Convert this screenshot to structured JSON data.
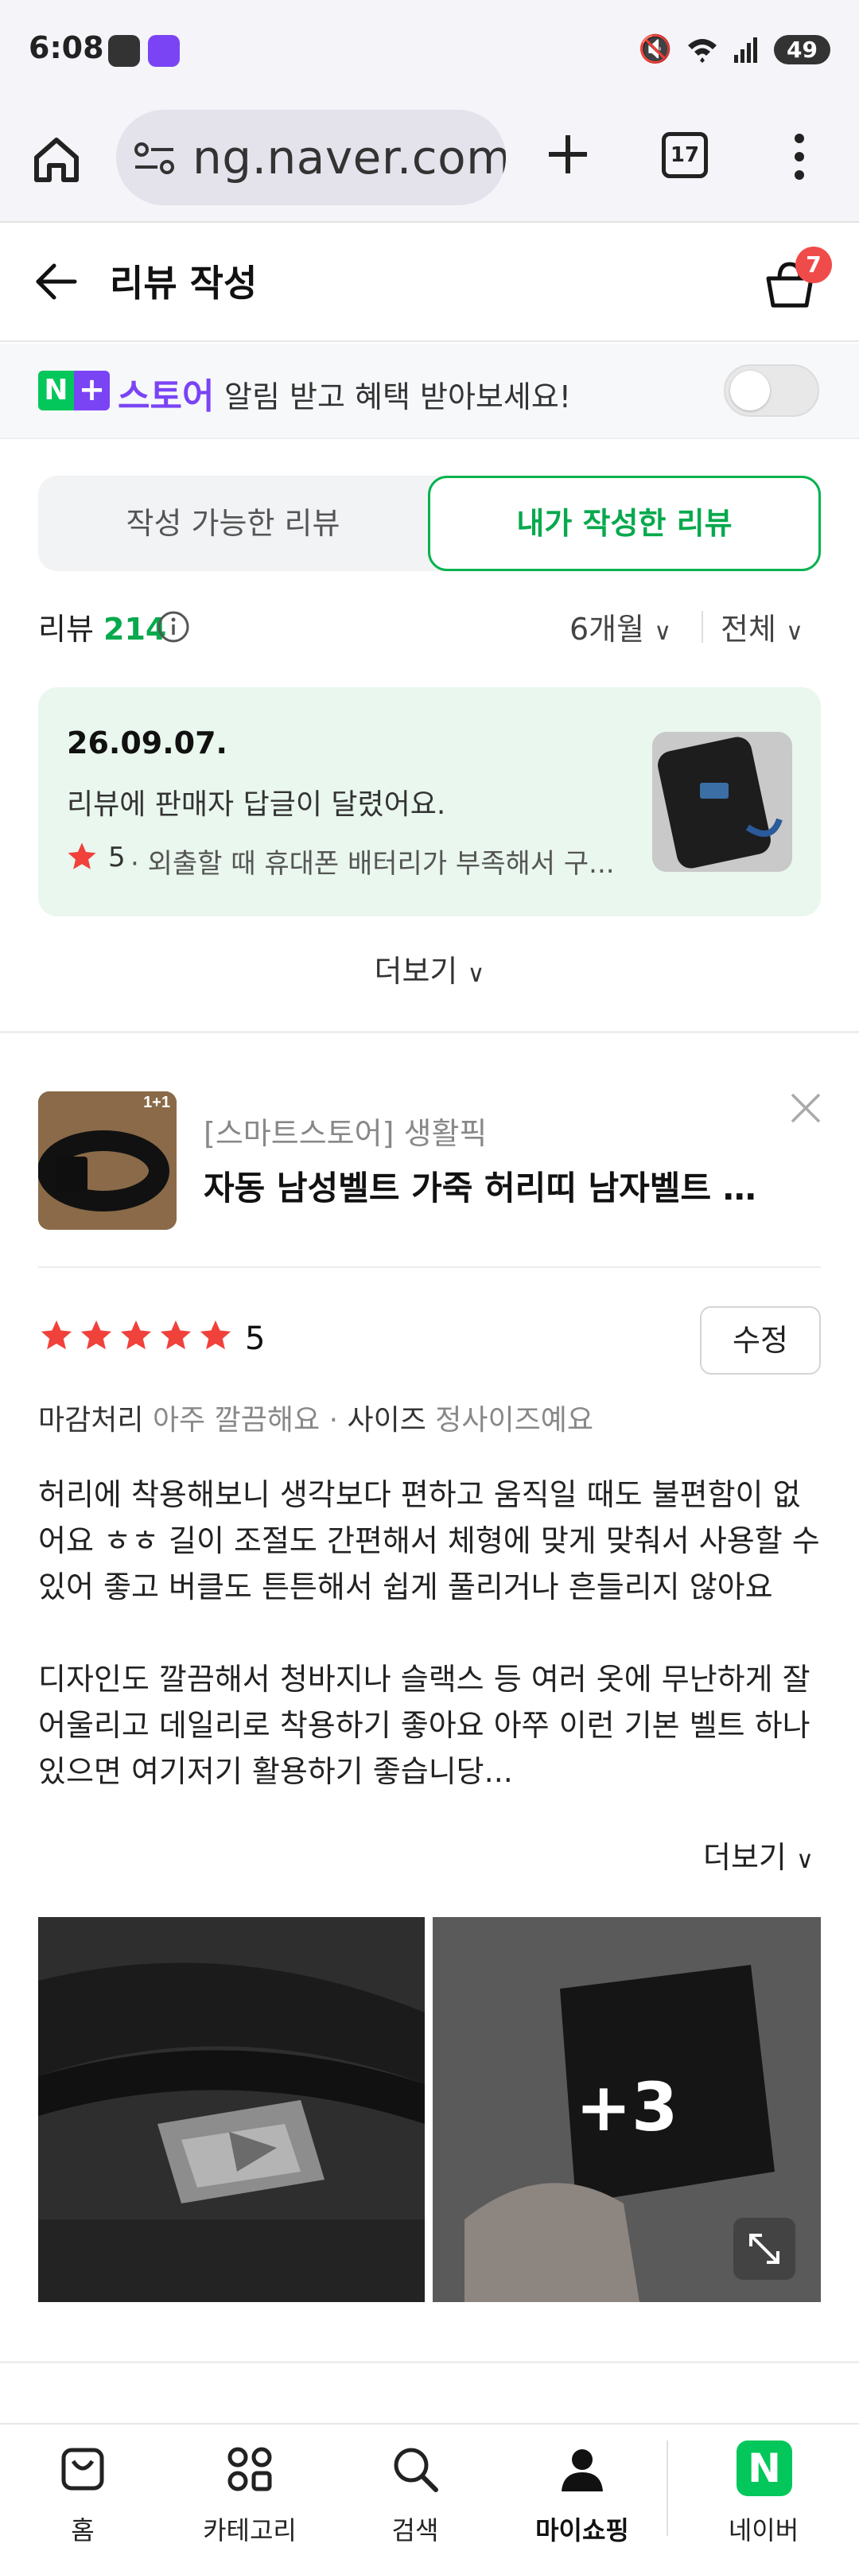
{
  "status_bar": {
    "time": "6:08",
    "battery": "49"
  },
  "browser": {
    "url": "ng.naver.com",
    "tab_count": "17"
  },
  "header": {
    "title": "리뷰 작성",
    "cart_badge": "7"
  },
  "banner": {
    "badge_n": "N",
    "badge_plus": "+",
    "store": "스토어",
    "text": "알림 받고 혜택 받아보세요!"
  },
  "tabs": {
    "writable": "작성 가능한 리뷰",
    "mine": "내가 작성한 리뷰",
    "selected": "mine"
  },
  "review_summary": {
    "label": "리뷰",
    "count": "214",
    "period": "6개월",
    "scope": "전체"
  },
  "reply_card": {
    "date": "26.09.07.",
    "message": "리뷰에 판매자 답글이 달렸어요.",
    "score": "5",
    "snippet": "· 외출할 때 휴대폰 배터리가 부족해서 구..."
  },
  "more_label": "더보기",
  "review": {
    "seller": "[스마트스토어] 생활픽",
    "product_name": "자동 남성벨트 가죽 허리띠 남자벨트 ...",
    "thumb_badge": "1+1",
    "rating": "5",
    "edit_label": "수정",
    "attr1_label": "마감처리",
    "attr1_value": "아주 깔끔해요",
    "attr2_label": "사이즈",
    "attr2_value": "정사이즈예요",
    "body": [
      "허리에 착용해보니 생각보다 편하고 움직일 때도 불편함이 없어요 ㅎㅎ 길이 조절도 간편해서 체형에 맞게 맞춰서 사용할 수 있어 좋고 버클도 튼튼해서 쉽게 풀리거나 흔들리지 않아요",
      "디자인도 깔끔해서 청바지나 슬랙스 등 여러 옷에 무난하게 잘 어울리고 데일리로 착용하기 좋아요 아쭈 이런 기본 벨트 하나 있으면 여기저기 활용하기 좋습니당..."
    ],
    "more_label": "더보기",
    "extra_photos": "+3"
  },
  "bottom_nav": [
    {
      "label": "홈",
      "icon": "home-bag-icon"
    },
    {
      "label": "카테고리",
      "icon": "category-icon"
    },
    {
      "label": "검색",
      "icon": "search-icon"
    },
    {
      "label": "마이쇼핑",
      "icon": "person-icon"
    },
    {
      "label": "네이버",
      "icon": "naver-logo-icon"
    }
  ],
  "colors": {
    "naver_green": "#03c75a",
    "store_purple": "#7a44f5",
    "star_red": "#f0413b",
    "badge_red": "#f04b4b"
  }
}
